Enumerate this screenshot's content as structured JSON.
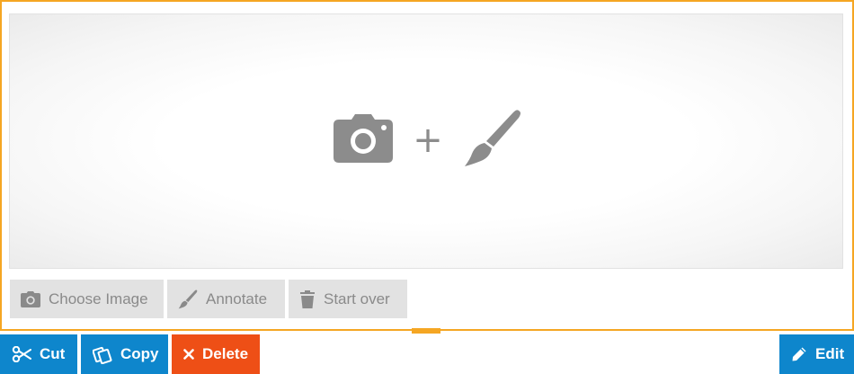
{
  "canvas": {
    "placeholder_plus": "+",
    "icons": [
      "camera-icon",
      "paintbrush-icon"
    ]
  },
  "tools": {
    "choose_image": "Choose Image",
    "annotate": "Annotate",
    "start_over": "Start over"
  },
  "actions": {
    "cut": "Cut",
    "copy": "Copy",
    "delete": "Delete",
    "edit": "Edit"
  },
  "colors": {
    "frame_border": "#f5a623",
    "action_blue": "#0e86cc",
    "delete_orange": "#ee4f16",
    "tool_gray": "#e2e2e2"
  }
}
